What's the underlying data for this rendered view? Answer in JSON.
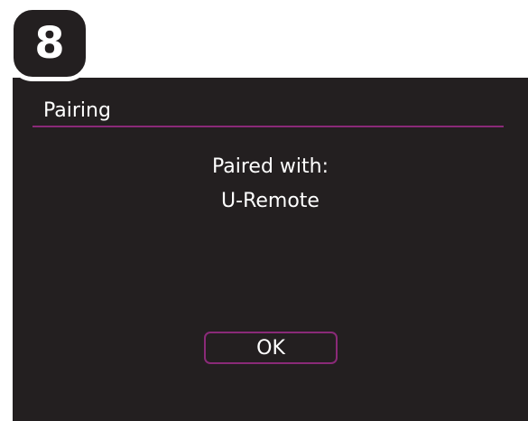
{
  "step_badge": "8",
  "screen": {
    "title": "Pairing",
    "message_line1": "Paired with:",
    "message_line2": "U-Remote",
    "ok_label": "OK"
  },
  "colors": {
    "screen_background": "#231f20",
    "accent": "#8a2a78",
    "text": "#ffffff"
  }
}
